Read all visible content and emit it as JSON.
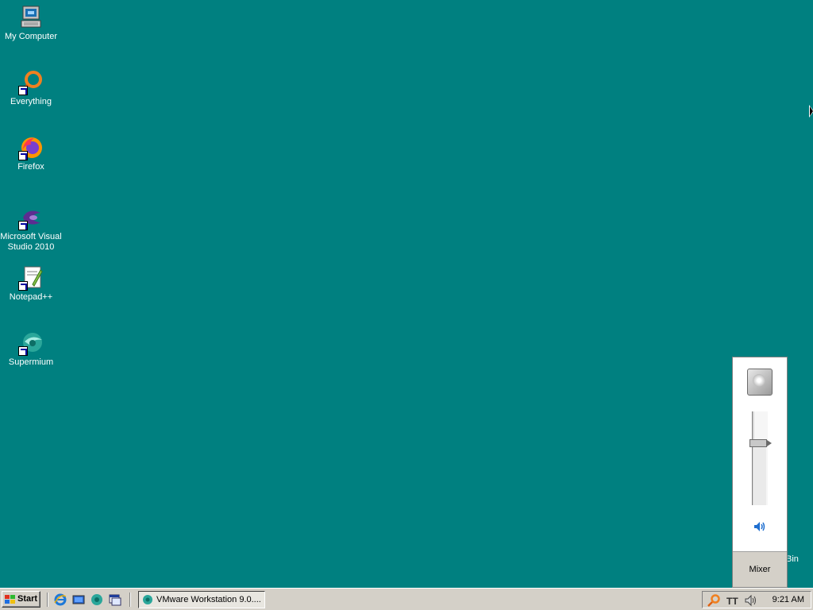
{
  "desktop": {
    "background_color": "#008080",
    "icons": [
      {
        "label": "My Computer",
        "icon": "my-computer-icon"
      },
      {
        "label": "Everything",
        "icon": "everything-search-icon"
      },
      {
        "label": "Firefox",
        "icon": "firefox-icon"
      },
      {
        "label": "Microsoft Visual\nStudio 2010",
        "icon": "visual-studio-icon"
      },
      {
        "label": "Notepad++",
        "icon": "notepad-plus-plus-icon"
      },
      {
        "label": "Supermium",
        "icon": "supermium-icon"
      }
    ],
    "partial_label": "Bin"
  },
  "volume_popup": {
    "level_fraction": 0.68,
    "mixer_label": "Mixer"
  },
  "taskbar": {
    "start_label": "Start",
    "quick_launch": [
      "internet-explorer-icon",
      "show-desktop-icon",
      "supermium-icon",
      "window-switcher-icon"
    ],
    "task_button_label": "VMware Workstation 9.0....",
    "tray_icons": [
      "search-icon",
      "language-icon",
      "volume-icon"
    ],
    "clock": "9:21 AM"
  }
}
